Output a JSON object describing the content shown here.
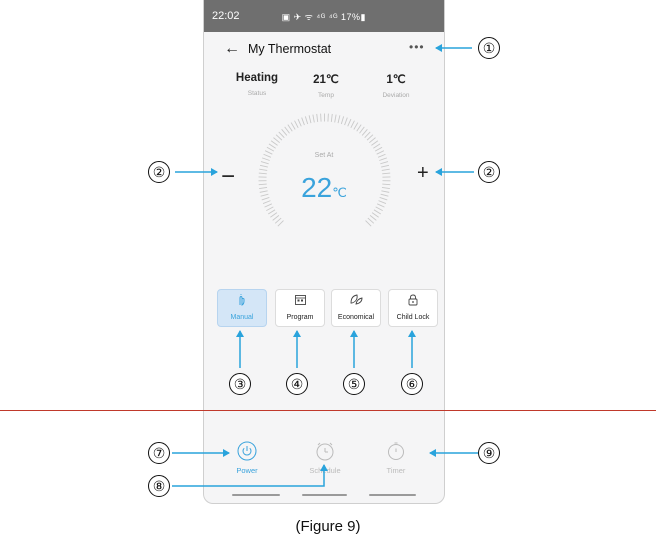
{
  "status_bar": {
    "time": "22:02",
    "indicators": "▣ ✈ ᯤ ⁴ᴳ ⁴ᴳ 17%▮"
  },
  "app_bar": {
    "back_icon": "arrow-left-icon",
    "title": "My Thermostat",
    "more": "•••"
  },
  "stats": [
    {
      "value": "Heating",
      "label": "Status"
    },
    {
      "value": "21℃",
      "label": "Temp"
    },
    {
      "value": "1℃",
      "label": "Deviation"
    }
  ],
  "dial": {
    "set_label": "Set At",
    "value": "22",
    "unit": "℃"
  },
  "controls": {
    "minus": "−",
    "plus": "+"
  },
  "modes": [
    {
      "label": "Manual",
      "icon": "hand-icon",
      "active": true
    },
    {
      "label": "Program",
      "icon": "calendar-icon",
      "active": false
    },
    {
      "label": "Economical",
      "icon": "leaf-icon",
      "active": false
    },
    {
      "label": "Child Lock",
      "icon": "lock-icon",
      "active": false
    }
  ],
  "bottom_nav": [
    {
      "label": "Power",
      "icon": "power-icon",
      "active": true
    },
    {
      "label": "Schedule",
      "icon": "clock-icon",
      "active": false
    },
    {
      "label": "Timer",
      "icon": "stopwatch-icon",
      "active": false
    }
  ],
  "callouts": [
    "①",
    "②",
    "②",
    "③",
    "④",
    "⑤",
    "⑥",
    "⑦",
    "⑧",
    "⑨"
  ],
  "caption": "(Figure 9)",
  "colors": {
    "accent": "#3aa3dc",
    "arrow": "#29a3dc",
    "active_mode_bg": "#d4e6f7",
    "separator": "#c0392b"
  }
}
